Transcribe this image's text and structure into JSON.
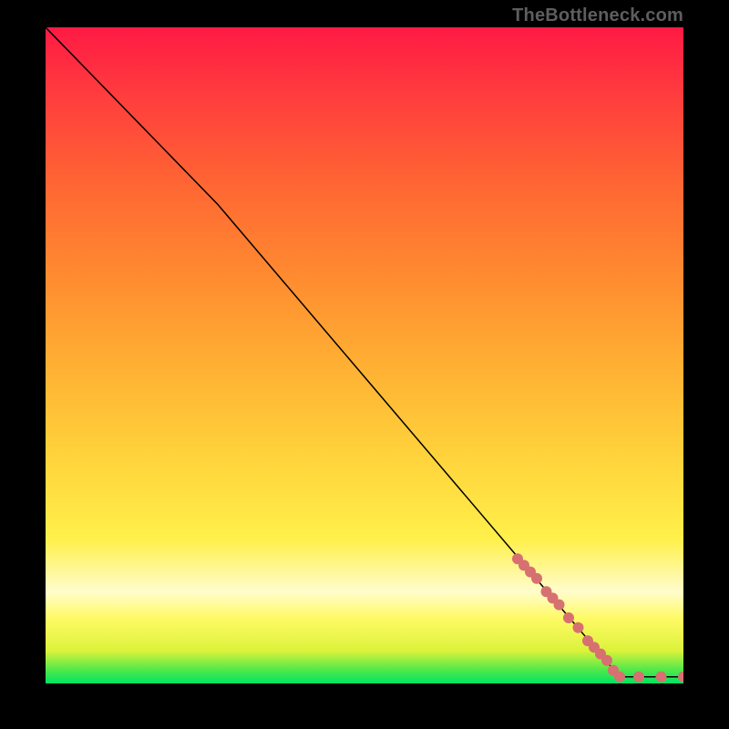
{
  "attribution": "TheBottleneck.com",
  "chart_data": {
    "type": "line",
    "title": "",
    "xlabel": "",
    "ylabel": "",
    "xlim": [
      0,
      100
    ],
    "ylim": [
      0,
      100
    ],
    "grid": false,
    "legend": false,
    "background": {
      "type": "vertical-gradient",
      "stops": [
        {
          "pos": 0.0,
          "color": "#ff1a44"
        },
        {
          "pos": 0.1,
          "color": "#ff3b3e"
        },
        {
          "pos": 0.24,
          "color": "#ff6633"
        },
        {
          "pos": 0.38,
          "color": "#ff8b30"
        },
        {
          "pos": 0.52,
          "color": "#ffb133"
        },
        {
          "pos": 0.65,
          "color": "#ffd23b"
        },
        {
          "pos": 0.78,
          "color": "#fff04a"
        },
        {
          "pos": 0.86,
          "color": "#fffccc"
        },
        {
          "pos": 0.9,
          "color": "#fffa66"
        },
        {
          "pos": 0.95,
          "color": "#dcf23a"
        },
        {
          "pos": 0.98,
          "color": "#4ee84a"
        },
        {
          "pos": 1.0,
          "color": "#00e463"
        }
      ]
    },
    "series": [
      {
        "name": "bottleneck-curve",
        "type": "line",
        "color": "#000000",
        "width": 1.5,
        "points": [
          {
            "x": 0,
            "y": 100
          },
          {
            "x": 27,
            "y": 73
          },
          {
            "x": 90,
            "y": 1
          },
          {
            "x": 100,
            "y": 1
          }
        ]
      },
      {
        "name": "sample-points",
        "type": "scatter",
        "color": "#d77070",
        "radius": 6,
        "points": [
          {
            "x": 74.0,
            "y": 19.0
          },
          {
            "x": 75.0,
            "y": 18.0
          },
          {
            "x": 76.0,
            "y": 17.0
          },
          {
            "x": 77.0,
            "y": 16.0
          },
          {
            "x": 78.5,
            "y": 14.0
          },
          {
            "x": 79.5,
            "y": 13.0
          },
          {
            "x": 80.5,
            "y": 12.0
          },
          {
            "x": 82.0,
            "y": 10.0
          },
          {
            "x": 83.5,
            "y": 8.5
          },
          {
            "x": 85.0,
            "y": 6.5
          },
          {
            "x": 86.0,
            "y": 5.5
          },
          {
            "x": 87.0,
            "y": 4.5
          },
          {
            "x": 88.0,
            "y": 3.5
          },
          {
            "x": 89.0,
            "y": 2.0
          },
          {
            "x": 90.0,
            "y": 1.0
          },
          {
            "x": 93.0,
            "y": 1.0
          },
          {
            "x": 96.5,
            "y": 1.0
          },
          {
            "x": 100.0,
            "y": 1.0
          }
        ]
      }
    ]
  }
}
